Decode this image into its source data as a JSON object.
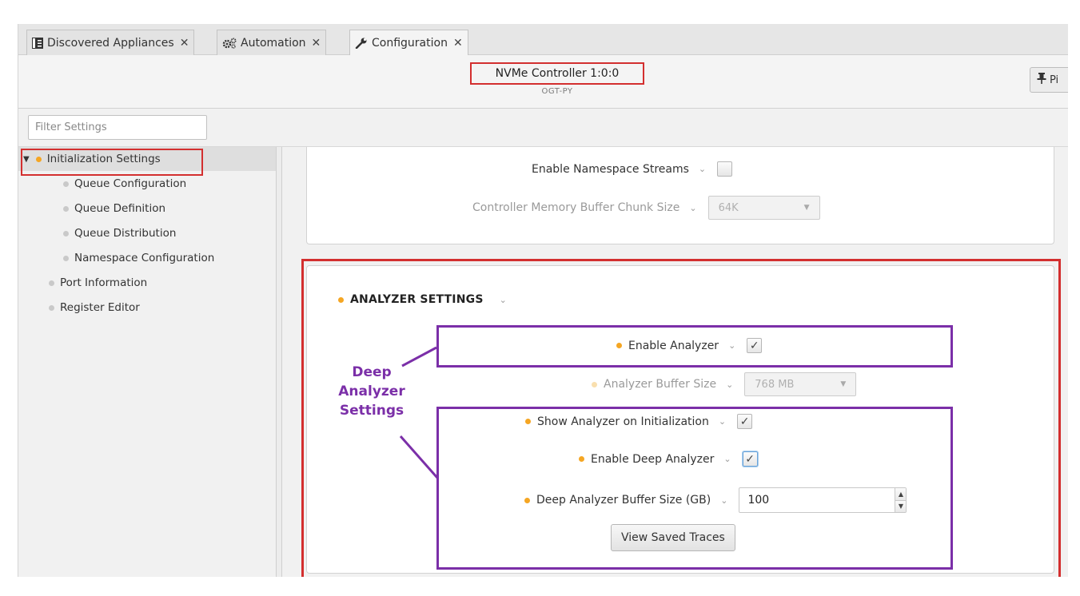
{
  "tabs": [
    {
      "label": "Discovered Appliances",
      "icon": "appliance-list-icon",
      "close": "✕"
    },
    {
      "label": "Automation",
      "icon": "gears-icon",
      "close": "✕"
    },
    {
      "label": "Configuration",
      "icon": "wrench-icon",
      "close": "✕",
      "active": true
    }
  ],
  "header": {
    "title": "NVMe Controller 1:0:0",
    "subtitle": "OGT-PY",
    "pin_label": "Pi"
  },
  "filter": {
    "placeholder": "Filter Settings"
  },
  "tree": {
    "items": [
      {
        "label": "Initialization Settings",
        "selected": true,
        "expanded": true
      },
      {
        "label": "Queue Configuration"
      },
      {
        "label": "Queue Definition"
      },
      {
        "label": "Queue Distribution"
      },
      {
        "label": "Namespace Configuration"
      },
      {
        "label": "Port Information"
      },
      {
        "label": "Register Editor"
      }
    ]
  },
  "top_panel": {
    "namespace_streams": {
      "label": "Enable Namespace Streams",
      "checked": false
    },
    "cmb_chunk": {
      "label": "Controller Memory Buffer Chunk Size",
      "value": "64K"
    }
  },
  "analyzer": {
    "title": "ANALYZER SETTINGS",
    "enable_analyzer": {
      "label": "Enable Analyzer",
      "checked": true
    },
    "buffer_size": {
      "label": "Analyzer Buffer Size",
      "value": "768 MB"
    },
    "show_on_init": {
      "label": "Show Analyzer on Initialization",
      "checked": true
    },
    "enable_deep": {
      "label": "Enable Deep Analyzer",
      "checked": true
    },
    "deep_buffer": {
      "label": "Deep Analyzer Buffer Size (GB)",
      "value": "100"
    },
    "view_traces_label": "View Saved Traces"
  },
  "annotation": {
    "line1": "Deep",
    "line2": "Analyzer",
    "line3": "Settings"
  },
  "colors": {
    "highlight_red": "#d32f2f",
    "annotation_purple": "#7b2fa8",
    "status_orange": "#f5a623"
  },
  "glyphs": {
    "check": "✓",
    "chevron": "⌄",
    "caret": "▼",
    "select_arrow": "▼",
    "up": "▲",
    "down": "▼"
  }
}
